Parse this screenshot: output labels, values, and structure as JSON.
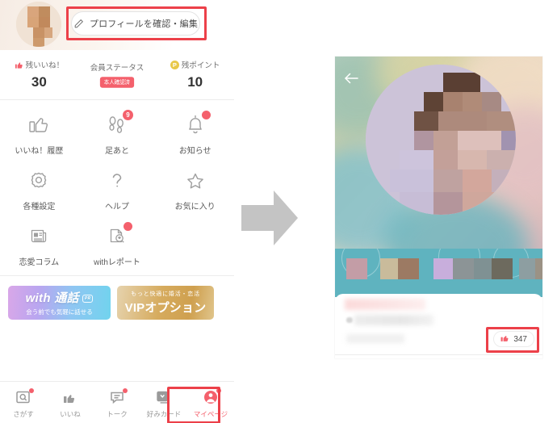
{
  "left_screen": {
    "edit_profile": {
      "label": "プロフィールを確認・編集",
      "icon": "pencil-icon"
    },
    "stats": [
      {
        "label": "残いいね！",
        "value": "30",
        "icon": "thumbs-up-icon"
      },
      {
        "label": "会員ステータス",
        "badge": "本人確認済",
        "icon": "none"
      },
      {
        "label": "残ポイント",
        "value": "10",
        "icon": "point-coin-icon"
      }
    ],
    "menu_items": [
      {
        "label": "いいね！履歴",
        "icon": "thumbs-up-icon",
        "badge": ""
      },
      {
        "label": "足あと",
        "icon": "footprints-icon",
        "badge": "9"
      },
      {
        "label": "お知らせ",
        "icon": "bell-icon",
        "badge": "dot"
      },
      {
        "label": "各種設定",
        "icon": "gear-icon",
        "badge": ""
      },
      {
        "label": "ヘルプ",
        "icon": "question-mark-icon",
        "badge": ""
      },
      {
        "label": "お気に入り",
        "icon": "star-icon",
        "badge": ""
      },
      {
        "label": "恋愛コラム",
        "icon": "newspaper-icon",
        "badge": ""
      },
      {
        "label": "withレポート",
        "icon": "report-search-icon",
        "badge": "dot"
      }
    ],
    "banners": [
      {
        "title": "with 通話",
        "subtitle": "会う前でも気軽に話せる",
        "tag": "PR"
      },
      {
        "title": "もっと快適に婚活・恋活",
        "subtitle": "VIPオプション"
      }
    ],
    "tabs": [
      {
        "label": "さがす",
        "icon": "search-card-icon",
        "badge": "dot",
        "active": false
      },
      {
        "label": "いいね",
        "icon": "thumbs-up-icon",
        "badge": "",
        "active": false
      },
      {
        "label": "トーク",
        "icon": "chat-icon",
        "badge": "dot",
        "active": false
      },
      {
        "label": "好みカード",
        "icon": "cards-icon",
        "badge": "",
        "active": false
      },
      {
        "label": "マイページ",
        "icon": "my-page-person-icon",
        "badge": "dot",
        "active": true
      }
    ]
  },
  "arrow": {
    "icon": "right-arrow-icon",
    "color": "#c4c4c4"
  },
  "right_screen": {
    "back": {
      "icon": "back-arrow-icon"
    },
    "like_counter": {
      "count": "347",
      "icon": "thumbs-up-icon"
    }
  },
  "colors": {
    "accent": "#f4606c",
    "highlight": "#ec4049",
    "text": "#4a4a4a",
    "muted": "#9a9a9a",
    "arrow": "#c4c4c4"
  }
}
